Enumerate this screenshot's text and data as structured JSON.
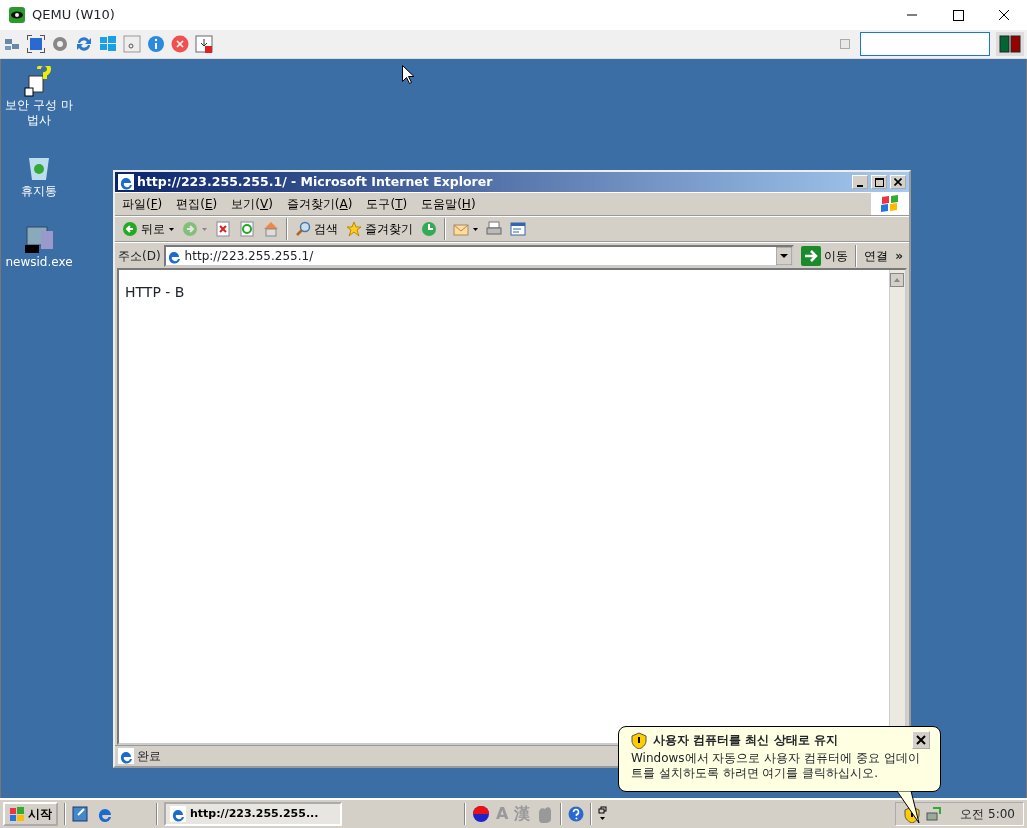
{
  "window": {
    "title": "QEMU (W10)"
  },
  "desktop_icons": [
    {
      "kind": "wizard",
      "label": "보안 구성 마법사"
    },
    {
      "kind": "recycle",
      "label": "휴지통"
    },
    {
      "kind": "program",
      "label": "newsid.exe"
    }
  ],
  "browser": {
    "title": "http://223.255.255.1/ - Microsoft Internet Explorer",
    "menu": [
      "파일(F)",
      "편집(E)",
      "보기(V)",
      "즐겨찾기(A)",
      "도구(T)",
      "도움말(H)"
    ],
    "toolbar": [
      {
        "kind": "back",
        "label": "뒤로",
        "disabled": false
      },
      {
        "kind": "forward",
        "disabled": true
      },
      {
        "kind": "stop"
      },
      {
        "kind": "refresh"
      },
      {
        "kind": "home"
      },
      {
        "kind": "search",
        "label": "검색"
      },
      {
        "kind": "favorites",
        "label": "즐겨찾기"
      },
      {
        "kind": "history"
      },
      {
        "kind": "mail"
      },
      {
        "kind": "print"
      },
      {
        "kind": "edit"
      }
    ],
    "address_label": "주소(D)",
    "address": "http://223.255.255.1/",
    "go": "이동",
    "links": "연결",
    "links_more": "»",
    "content": "HTTP - B",
    "status": "완료"
  },
  "balloon": {
    "title": "사용자 컴퓨터를 최신 상태로 유지",
    "text": "Windows에서 자동으로 사용자 컴퓨터에 중요 업데이트를 설치하도록 하려면 여기를 클릭하십시오."
  },
  "taskbar": {
    "start": "시작",
    "tasks": [
      {
        "label": "http://223.255.255...",
        "selected": true
      }
    ],
    "ime": [
      "A",
      "漢"
    ],
    "clock": "오전 5:00"
  }
}
